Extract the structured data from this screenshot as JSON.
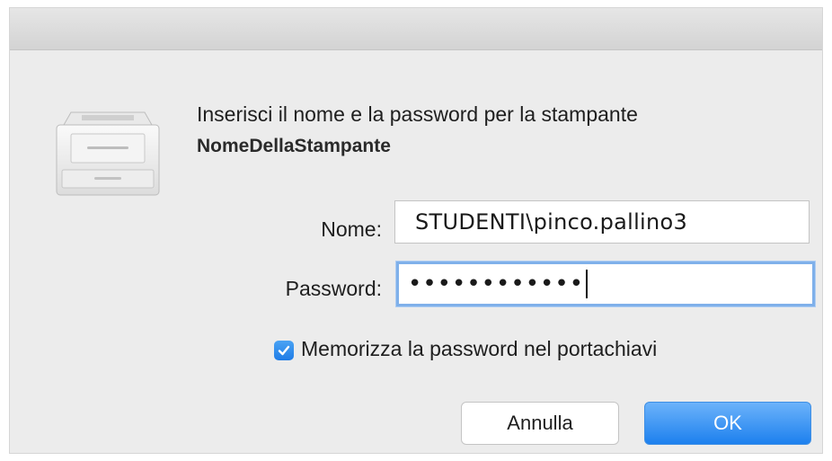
{
  "dialog": {
    "message_line1": "Inserisci il nome e la password per la stampante",
    "message_line2": "NomeDellaStampante",
    "icon": "printer-icon"
  },
  "form": {
    "nome_label": "Nome:",
    "nome_value": "STUDENTI\\pinco.pallino3",
    "password_label": "Password:",
    "password_value": "••••••••••••",
    "remember_label": "Memorizza la password nel portachiavi",
    "remember_checked": true
  },
  "buttons": {
    "cancel_label": "Annulla",
    "ok_label": "OK"
  },
  "colors": {
    "accent": "#1f7ce6",
    "focus_ring": "#7fb0ea",
    "dialog_bg": "#ececec"
  }
}
